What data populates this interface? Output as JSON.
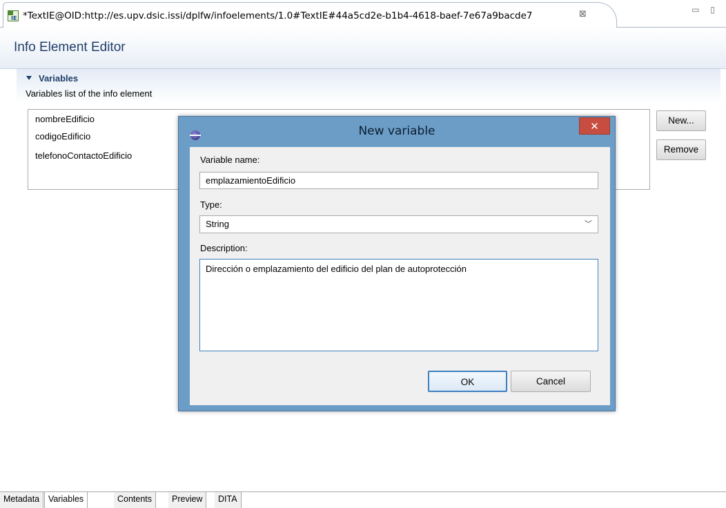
{
  "tab": {
    "title": "*TextIE@OID:http://es.upv.dsic.issi/dplfw/infoelements/1.0#TextIE#44a5cd2e-b1b4-4618-baef-7e67a9bacde7",
    "close_icon": "⊠",
    "window_controls": "▭ ▯"
  },
  "editor": {
    "title": "Info Element Editor",
    "section": {
      "title": "Variables",
      "description": "Variables list of the info element"
    },
    "variables": [
      "nombreEdificio",
      "codigoEdificio",
      "telefonoContactoEdificio"
    ],
    "buttons": {
      "new": "New...",
      "remove": "Remove"
    }
  },
  "dialog": {
    "title": "New variable",
    "close": "✕",
    "name_label": "Variable name:",
    "name_value": "emplazamientoEdificio",
    "type_label": "Type:",
    "type_value": "String",
    "description_label": "Description:",
    "description_value": "Dirección o emplazamiento del edificio del plan de autoprotección",
    "ok": "OK",
    "cancel": "Cancel"
  },
  "bottom_tabs": [
    "Metadata",
    "Variables",
    "Contents",
    "Preview",
    "DITA"
  ],
  "bottom_tab_active": "Variables"
}
